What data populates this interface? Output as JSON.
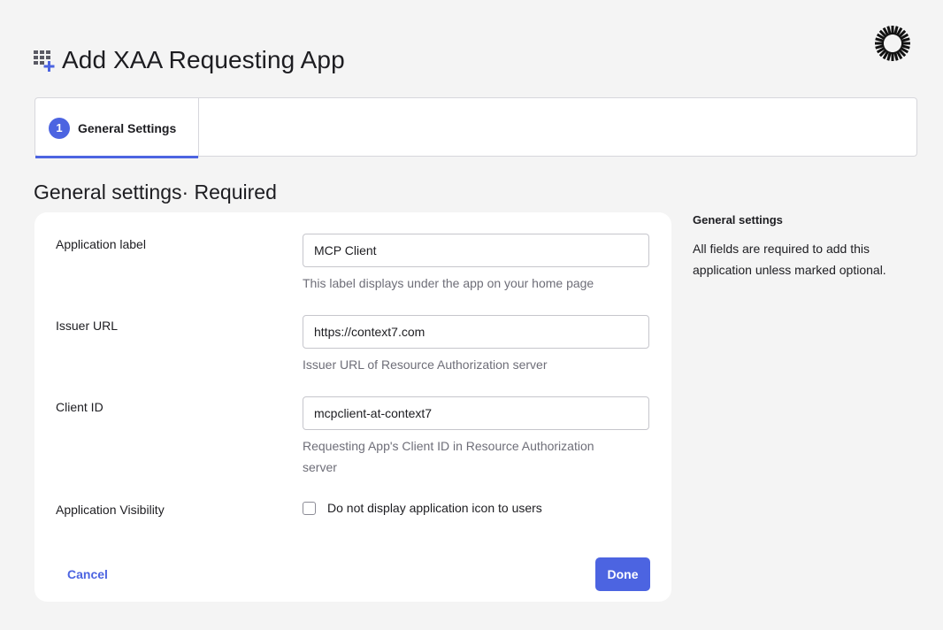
{
  "header": {
    "title": "Add XAA Requesting App",
    "icon": "grid-add-icon",
    "logo": "sunburst-logo-icon"
  },
  "steps": [
    {
      "number": "1",
      "label": "General Settings",
      "active": true
    }
  ],
  "section": {
    "title": "General settings· Required"
  },
  "form": {
    "app_label": {
      "label": "Application label",
      "value": "MCP Client",
      "hint": "This label displays under the app on your home page"
    },
    "issuer_url": {
      "label": "Issuer URL",
      "value": "https://context7.com",
      "hint": "Issuer URL of Resource Authorization server"
    },
    "client_id": {
      "label": "Client ID",
      "value": "mcpclient-at-context7",
      "hint": "Requesting App's Client ID in Resource Authorization server"
    },
    "visibility": {
      "label": "Application Visibility",
      "checkbox_label": "Do not display application icon to users",
      "checked": false
    },
    "cancel_label": "Cancel",
    "done_label": "Done"
  },
  "aside": {
    "title": "General settings",
    "text": "All fields are required to add this application unless marked optional."
  },
  "colors": {
    "accent": "#4c64e1",
    "background": "#f4f4f4",
    "card": "#ffffff",
    "hint": "#6e6e78"
  }
}
